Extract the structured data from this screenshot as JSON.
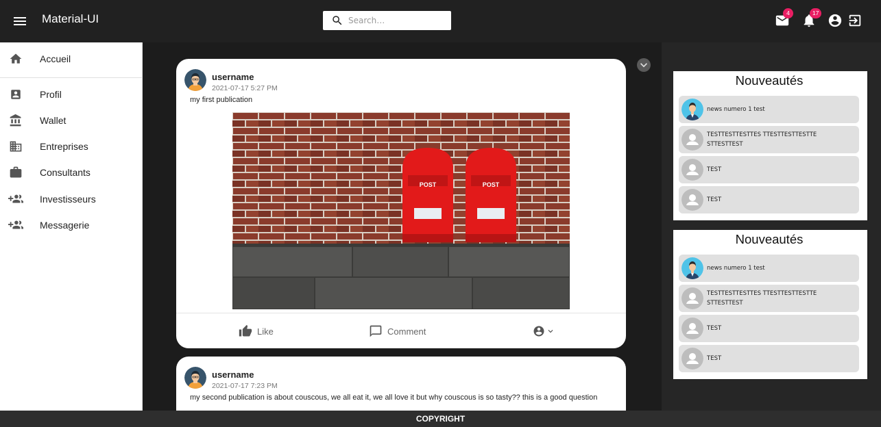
{
  "appbar": {
    "title": "Material-UI",
    "search_placeholder": "Search…",
    "mail_badge": "4",
    "notifications_badge": "17"
  },
  "sidebar": {
    "items": [
      {
        "label": "Accueil",
        "icon": "home-icon"
      },
      {
        "label": "Profil",
        "icon": "account-box-icon"
      },
      {
        "label": "Wallet",
        "icon": "bank-icon"
      },
      {
        "label": "Entreprises",
        "icon": "business-icon"
      },
      {
        "label": "Consultants",
        "icon": "work-icon"
      },
      {
        "label": "Investisseurs",
        "icon": "group-add-icon"
      },
      {
        "label": "Messagerie",
        "icon": "group-add-icon"
      }
    ]
  },
  "posts": [
    {
      "username": "username",
      "date": "2021-07-17 5:27 PM",
      "text": "my first publication",
      "image": "red-post-boxes-on-brick-wall"
    },
    {
      "username": "username",
      "date": "2021-07-17 7:23 PM",
      "text": "my second publication is about couscous, we all eat it, we all love it but why couscous is so tasty?? this is a good question"
    }
  ],
  "actions": {
    "like": "Like",
    "comment": "Comment"
  },
  "news_cards": [
    {
      "title": "Nouveautés",
      "items": [
        {
          "text": "news numero 1 test",
          "avatar": "person-illustration"
        },
        {
          "text": "TESTTESTTESTTES TTESTTESTTESTTE STTESTTEST",
          "avatar": "default-person"
        },
        {
          "text": "TEST",
          "avatar": "default-person"
        },
        {
          "text": "TEST",
          "avatar": "default-person"
        }
      ]
    },
    {
      "title": "Nouveautés",
      "items": [
        {
          "text": "news numero 1 test",
          "avatar": "person-illustration"
        },
        {
          "text": "TESTTESTTESTTES TTESTTESTTESTTE STTESTTEST",
          "avatar": "default-person"
        },
        {
          "text": "TEST",
          "avatar": "default-person"
        },
        {
          "text": "TEST",
          "avatar": "default-person"
        }
      ]
    }
  ],
  "footer": {
    "text": "COPYRIGHT"
  },
  "colors": {
    "appbar": "#212121",
    "badge": "#e91e63",
    "background": "#1c1c1c",
    "card": "#ffffff",
    "news_item": "#e0e0e0"
  }
}
